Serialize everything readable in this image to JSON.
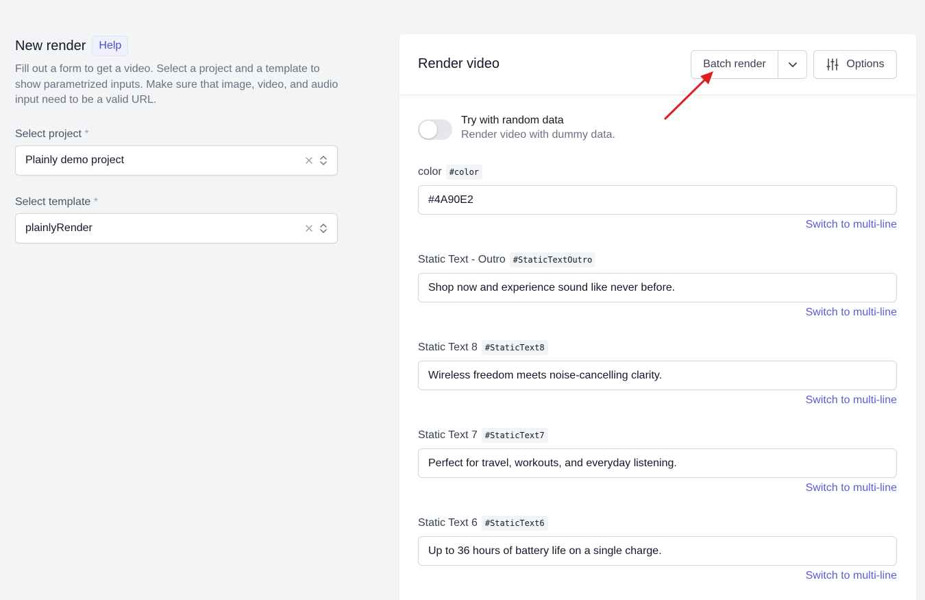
{
  "left": {
    "title": "New render",
    "help_label": "Help",
    "description": "Fill out a form to get a video. Select a project and a template to show parametrized inputs. Make sure that image, video, and audio input need to be a valid URL.",
    "project": {
      "label": "Select project",
      "required_mark": "*",
      "value": "Plainly demo project"
    },
    "template": {
      "label": "Select template",
      "required_mark": "*",
      "value": "plainlyRender"
    }
  },
  "panel": {
    "title": "Render video",
    "batch_label": "Batch render",
    "options_label": "Options",
    "random": {
      "title": "Try with random data",
      "subtitle": "Render video with dummy data."
    },
    "switch_label": "Switch to multi-line",
    "params": [
      {
        "name": "color",
        "key": "#color",
        "value": "#4A90E2"
      },
      {
        "name": "Static Text - Outro",
        "key": "#StaticTextOutro",
        "value": "Shop now and experience sound like never before."
      },
      {
        "name": "Static Text 8",
        "key": "#StaticText8",
        "value": "Wireless freedom meets noise-cancelling clarity."
      },
      {
        "name": "Static Text 7",
        "key": "#StaticText7",
        "value": "Perfect for travel, workouts, and everyday listening."
      },
      {
        "name": "Static Text 6",
        "key": "#StaticText6",
        "value": "Up to 36 hours of battery life on a single charge."
      }
    ]
  },
  "colors": {
    "accent": "#5b5bd6",
    "annotation_arrow": "#e11d1d"
  }
}
